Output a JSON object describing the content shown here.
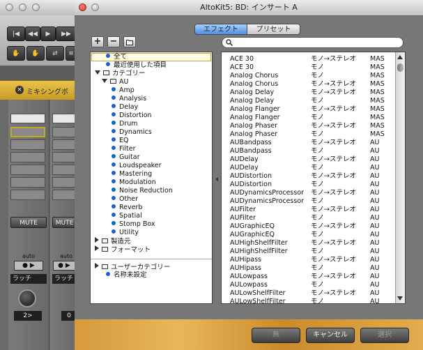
{
  "background_app": {
    "mixer_title": "ミキシングボ",
    "strips": [
      {
        "mute_label": "MUTE",
        "auto_label": "auto",
        "latch_label": "ラッチ",
        "value": "2>"
      },
      {
        "mute_label": "MUTE",
        "auto_label": "auto",
        "latch_label": "ラッチ",
        "value": "0"
      }
    ]
  },
  "dialog": {
    "title": "AltoKit5: BD: インサート A",
    "tabs": [
      {
        "label": "エフェクト",
        "selected": true
      },
      {
        "label": "プリセット",
        "selected": false
      }
    ],
    "toolbar": {
      "add_symbol": "+",
      "remove_symbol": "−",
      "folder_icon": "folder-icon"
    },
    "search": {
      "value": "",
      "placeholder": ""
    },
    "tree": {
      "items": [
        {
          "label": "全て",
          "kind": "bullet",
          "indent": 0
        },
        {
          "label": "最近使用した項目",
          "kind": "bullet",
          "indent": 0
        },
        {
          "label": "カテゴリー",
          "kind": "folder-open",
          "indent": 0
        },
        {
          "label": "AU",
          "kind": "folder",
          "indent": 1
        },
        {
          "label": "Amp",
          "kind": "bullet",
          "indent": 2
        },
        {
          "label": "Analysis",
          "kind": "bullet",
          "indent": 2
        },
        {
          "label": "Delay",
          "kind": "bullet",
          "indent": 2
        },
        {
          "label": "Distortion",
          "kind": "bullet",
          "indent": 2
        },
        {
          "label": "Drum",
          "kind": "bullet",
          "indent": 2
        },
        {
          "label": "Dynamics",
          "kind": "bullet",
          "indent": 2
        },
        {
          "label": "EQ",
          "kind": "bullet",
          "indent": 2
        },
        {
          "label": "Filter",
          "kind": "bullet",
          "indent": 2
        },
        {
          "label": "Guitar",
          "kind": "bullet",
          "indent": 2
        },
        {
          "label": "Loudspeaker",
          "kind": "bullet",
          "indent": 2
        },
        {
          "label": "Mastering",
          "kind": "bullet",
          "indent": 2
        },
        {
          "label": "Modulation",
          "kind": "bullet",
          "indent": 2
        },
        {
          "label": "Noise Reduction",
          "kind": "bullet",
          "indent": 2
        },
        {
          "label": "Other",
          "kind": "bullet",
          "indent": 2
        },
        {
          "label": "Reverb",
          "kind": "bullet",
          "indent": 2
        },
        {
          "label": "Spatial",
          "kind": "bullet",
          "indent": 2
        },
        {
          "label": "Stomp Box",
          "kind": "bullet",
          "indent": 2
        },
        {
          "label": "Utility",
          "kind": "bullet",
          "indent": 2
        },
        {
          "label": "製造元",
          "kind": "folder-closed",
          "indent": 0
        },
        {
          "label": "フォーマット",
          "kind": "folder-closed",
          "indent": 0
        }
      ],
      "user_items": [
        {
          "label": "ユーザーカテゴリー",
          "kind": "folder-closed",
          "indent": 0
        },
        {
          "label": "名称未設定",
          "kind": "bullet",
          "indent": 0
        }
      ]
    },
    "effects": [
      [
        "ACE 30",
        "モノ→ステレオ",
        "MAS"
      ],
      [
        "ACE 30",
        "モノ",
        "MAS"
      ],
      [
        "Analog Chorus",
        "モノ",
        "MAS"
      ],
      [
        "Analog Chorus",
        "モノ→ステレオ",
        "MAS"
      ],
      [
        "Analog Delay",
        "モノ→ステレオ",
        "MAS"
      ],
      [
        "Analog Delay",
        "モノ",
        "MAS"
      ],
      [
        "Analog Flanger",
        "モノ→ステレオ",
        "MAS"
      ],
      [
        "Analog Flanger",
        "モノ",
        "MAS"
      ],
      [
        "Analog Phaser",
        "モノ→ステレオ",
        "MAS"
      ],
      [
        "Analog Phaser",
        "モノ",
        "MAS"
      ],
      [
        "AUBandpass",
        "モノ→ステレオ",
        "AU"
      ],
      [
        "AUBandpass",
        "モノ",
        "AU"
      ],
      [
        "AUDelay",
        "モノ→ステレオ",
        "AU"
      ],
      [
        "AUDelay",
        "モノ",
        "AU"
      ],
      [
        "AUDistortion",
        "モノ→ステレオ",
        "AU"
      ],
      [
        "AUDistortion",
        "モノ",
        "AU"
      ],
      [
        "AUDynamicsProcessor",
        "モノ→ステレオ",
        "AU"
      ],
      [
        "AUDynamicsProcessor",
        "モノ",
        "AU"
      ],
      [
        "AUFilter",
        "モノ→ステレオ",
        "AU"
      ],
      [
        "AUFilter",
        "モノ",
        "AU"
      ],
      [
        "AUGraphicEQ",
        "モノ→ステレオ",
        "AU"
      ],
      [
        "AUGraphicEQ",
        "モノ",
        "AU"
      ],
      [
        "AUHighShelfFilter",
        "モノ→ステレオ",
        "AU"
      ],
      [
        "AUHighShelfFilter",
        "モノ",
        "AU"
      ],
      [
        "AUHipass",
        "モノ→ステレオ",
        "AU"
      ],
      [
        "AUHipass",
        "モノ",
        "AU"
      ],
      [
        "AULowpass",
        "モノ→ステレオ",
        "AU"
      ],
      [
        "AULowpass",
        "モノ",
        "AU"
      ],
      [
        "AULowShelfFilter",
        "モノ→ステレオ",
        "AU"
      ],
      [
        "AULowShelfFilter",
        "モノ",
        "AU"
      ]
    ],
    "buttons": {
      "none": "無",
      "cancel": "キャンセル",
      "select": "選択"
    },
    "colors": {
      "tab_selected": "#4f8fe0",
      "bullet": "#1f5ed6",
      "bottom_bar": "#d49a3c"
    }
  }
}
